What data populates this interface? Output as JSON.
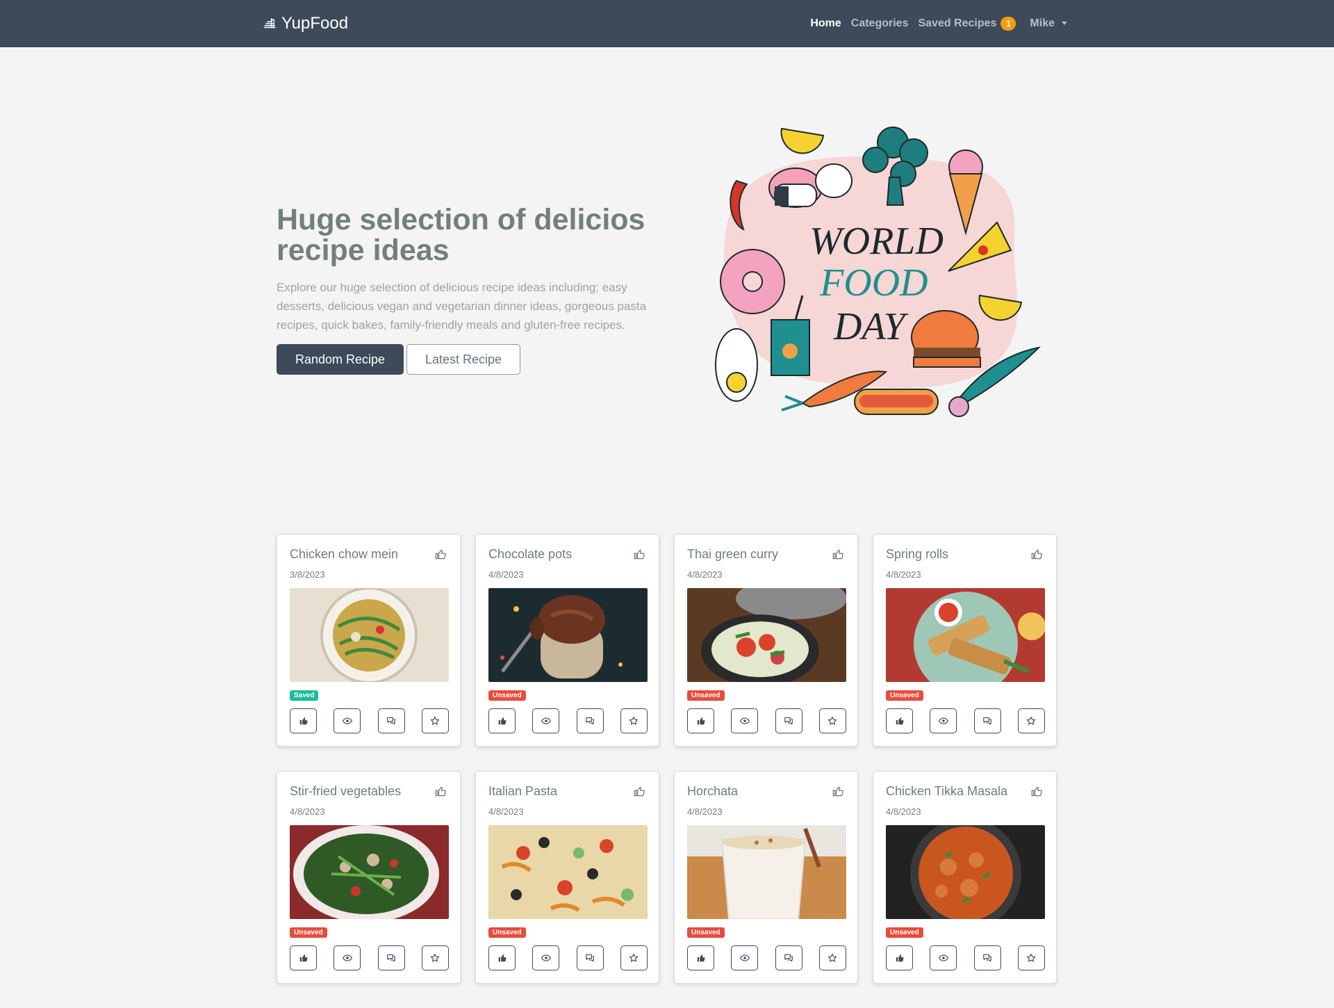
{
  "nav": {
    "brand": "YupFood",
    "links": [
      {
        "label": "Home",
        "active": true
      },
      {
        "label": "Categories",
        "active": false
      },
      {
        "label": "Saved Recipes",
        "active": false,
        "badge": "1"
      }
    ],
    "user": "Mike"
  },
  "hero": {
    "title": "Huge selection of delicios recipe ideas",
    "text": "Explore our huge selection of delicious recipe ideas including; easy desserts, delicious vegan and vegetarian dinner ideas, gorgeous pasta recipes, quick bakes, family-friendly meals and gluten-free recipes.",
    "primary_button": "Random Recipe",
    "secondary_button": "Latest Recipe",
    "illustration": {
      "line1": "WORLD",
      "line2": "FOOD",
      "line3": "DAY"
    }
  },
  "recipes": [
    {
      "title": "Chicken chow mein",
      "date": "3/8/2023",
      "status": "Saved",
      "image": "noodles"
    },
    {
      "title": "Chocolate pots",
      "date": "4/8/2023",
      "status": "Unsaved",
      "image": "chocolate"
    },
    {
      "title": "Thai green curry",
      "date": "4/8/2023",
      "status": "Unsaved",
      "image": "curry"
    },
    {
      "title": "Spring rolls",
      "date": "4/8/2023",
      "status": "Unsaved",
      "image": "springrolls"
    },
    {
      "title": "Stir-fried vegetables",
      "date": "4/8/2023",
      "status": "Unsaved",
      "image": "stirfry"
    },
    {
      "title": "Italian Pasta",
      "date": "4/8/2023",
      "status": "Unsaved",
      "image": "pasta"
    },
    {
      "title": "Horchata",
      "date": "4/8/2023",
      "status": "Unsaved",
      "image": "horchata"
    },
    {
      "title": "Chicken Tikka Masala",
      "date": "4/8/2023",
      "status": "Unsaved",
      "image": "tikka"
    }
  ],
  "colors": {
    "navbar": "#3c4a5a",
    "saved": "#1abc9c",
    "unsaved": "#e74c3c",
    "badge": "#f39c12"
  }
}
